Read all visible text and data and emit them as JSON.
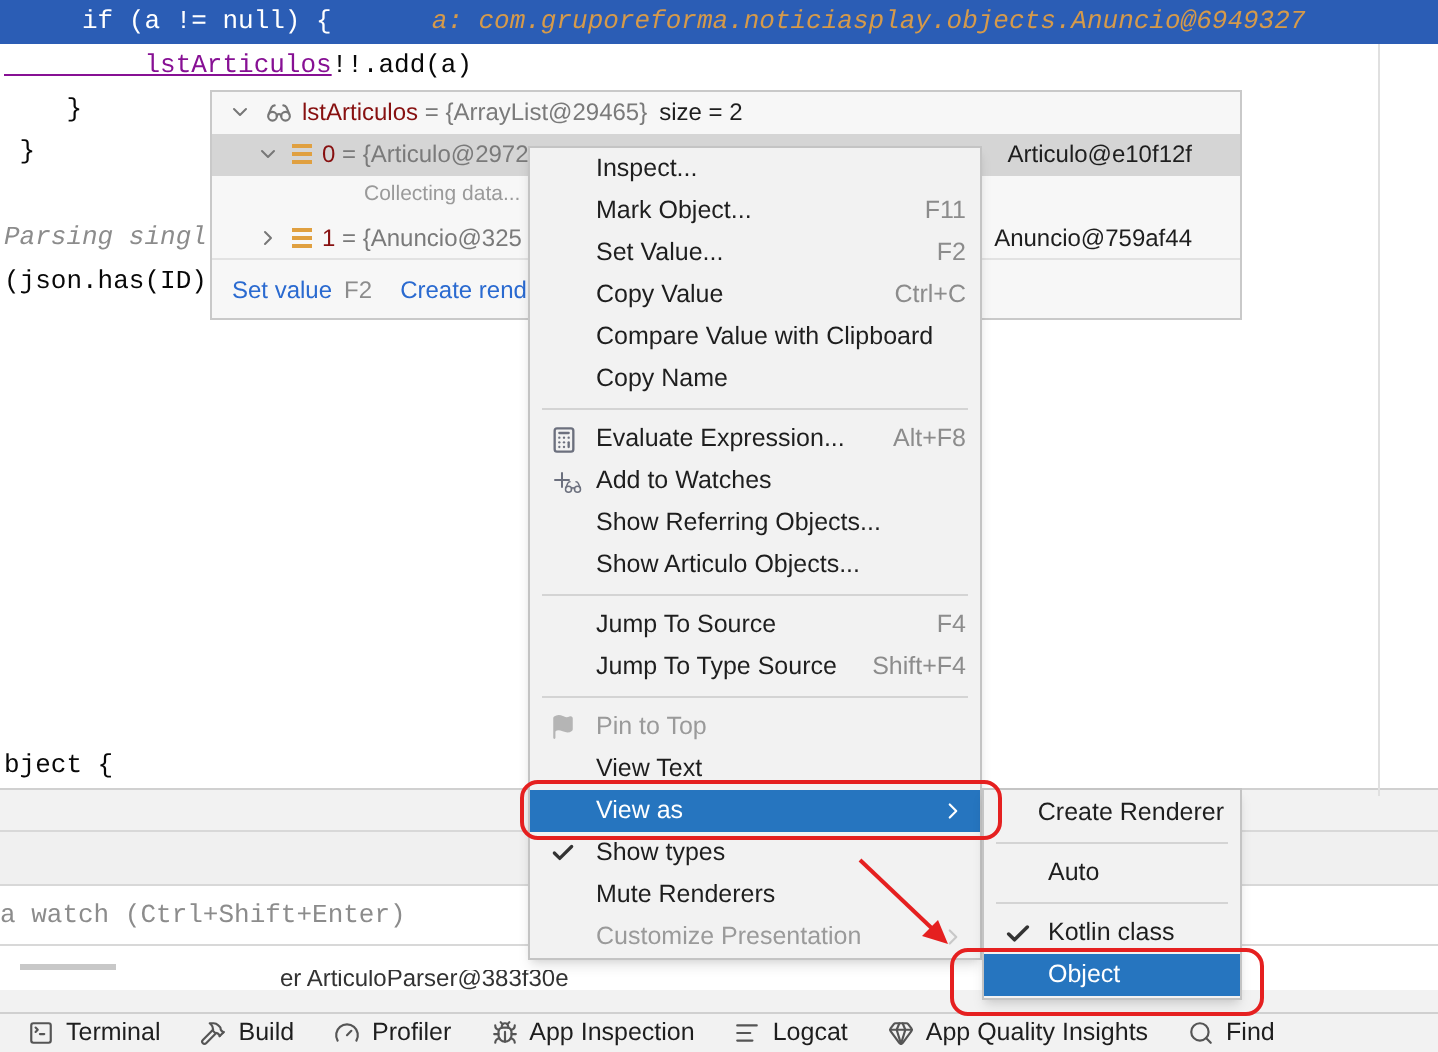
{
  "editor": {
    "current_line": {
      "code": "     if (a != null) {",
      "hint": "a: com.gruporeforma.noticiasplay.objects.Anuncio@6949327"
    },
    "lines": [
      {
        "kind": "call",
        "target": "         lstArticulos",
        "rest": "!!.add(a)"
      },
      {
        "kind": "code",
        "text": "    }"
      },
      {
        "kind": "code",
        "text": " }"
      },
      {
        "kind": "blank"
      },
      {
        "kind": "comment",
        "text": "Parsing singl"
      },
      {
        "kind": "code",
        "text": "(json.has(ID)"
      }
    ],
    "last_line": {
      "kind": "code",
      "text": "bject {"
    }
  },
  "debug_panel": {
    "watch_placeholder": "a watch (Ctrl+Shift+Enter)",
    "cut_value": "er ArticuloParser@383f30e"
  },
  "value_popup": {
    "root": {
      "expanded": true,
      "name": "lstArticulos",
      "value": " = {ArrayList@29465}",
      "extra": "size = 2"
    },
    "children": [
      {
        "expanded": true,
        "selected": true,
        "name": "0",
        "value": " = {Articulo@2972",
        "value_tail": "Articulo@e10f12f",
        "note": "Collecting data..."
      },
      {
        "expanded": false,
        "selected": false,
        "name": "1",
        "value": " = {Anuncio@325",
        "value_tail": "Anuncio@759af44"
      }
    ],
    "footer": [
      {
        "kind": "link",
        "text": "Set value"
      },
      {
        "kind": "key",
        "text": "F2"
      },
      {
        "kind": "link",
        "text": "Create rend"
      }
    ]
  },
  "context_menu": {
    "groups": [
      [
        {
          "label": "Inspect..."
        },
        {
          "label": "Mark Object...",
          "shortcut": "F11"
        },
        {
          "label": "Set Value...",
          "shortcut": "F2"
        },
        {
          "label": "Copy Value",
          "shortcut": "Ctrl+C"
        },
        {
          "label": "Compare Value with Clipboard"
        },
        {
          "label": "Copy Name"
        }
      ],
      [
        {
          "label": "Evaluate Expression...",
          "shortcut": "Alt+F8"
        },
        {
          "label": "Add to Watches"
        },
        {
          "label": "Show Referring Objects..."
        },
        {
          "label": "Show Articulo Objects..."
        }
      ],
      [
        {
          "label": "Jump To Source",
          "shortcut": "F4"
        },
        {
          "label": "Jump To Type Source",
          "shortcut": "Shift+F4"
        }
      ],
      [
        {
          "label": "Pin to Top",
          "disabled": true
        },
        {
          "label": "View Text"
        },
        {
          "label": "View as",
          "selected": true,
          "submenu": true
        },
        {
          "label": "Show types",
          "checked": true
        },
        {
          "label": "Mute Renderers"
        },
        {
          "label": "Customize Presentation",
          "disabled": true,
          "submenu": true
        }
      ]
    ]
  },
  "submenu": {
    "groups": [
      [
        {
          "label": "Create Renderer",
          "checked": false,
          "selected": false
        }
      ],
      [
        {
          "label": "Auto",
          "checked": false,
          "selected": false
        }
      ],
      [
        {
          "label": "Kotlin class",
          "checked": true,
          "selected": false
        },
        {
          "label": "Object",
          "checked": false,
          "selected": true
        }
      ]
    ]
  },
  "tool_bar": [
    {
      "label": "Terminal"
    },
    {
      "label": "Build"
    },
    {
      "label": "Profiler"
    },
    {
      "label": "App Inspection"
    },
    {
      "label": "Logcat"
    },
    {
      "label": "App Quality Insights"
    },
    {
      "label": "Find"
    }
  ]
}
